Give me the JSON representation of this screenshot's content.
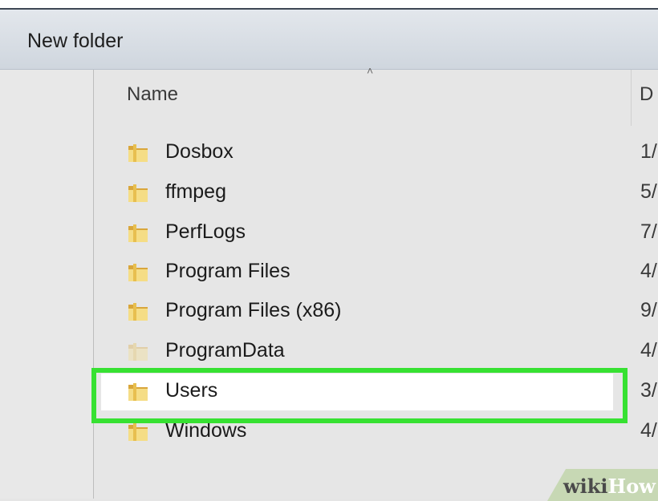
{
  "toolbar": {
    "new_folder_label": "New folder"
  },
  "columns": {
    "name": "Name",
    "date_partial": "D"
  },
  "rows": [
    {
      "name": "Dosbox",
      "date_partial": "1/"
    },
    {
      "name": "ffmpeg",
      "date_partial": "5/"
    },
    {
      "name": "PerfLogs",
      "date_partial": "7/"
    },
    {
      "name": "Program Files",
      "date_partial": "4/"
    },
    {
      "name": "Program Files (x86)",
      "date_partial": "9/"
    },
    {
      "name": "ProgramData",
      "date_partial": "4/"
    },
    {
      "name": "Users",
      "date_partial": "3/"
    },
    {
      "name": "Windows",
      "date_partial": "4/"
    }
  ],
  "highlight": {
    "target": "Users",
    "color": "#37e132"
  },
  "watermark": {
    "part1": "wiki",
    "part2": "How"
  },
  "icons": {
    "folder": "folder-icon",
    "sort": "sort-up-arrow-icon"
  },
  "colors": {
    "folder_light": "#f5dd86",
    "folder_dark": "#d9a63b",
    "highlight": "#37e132"
  }
}
